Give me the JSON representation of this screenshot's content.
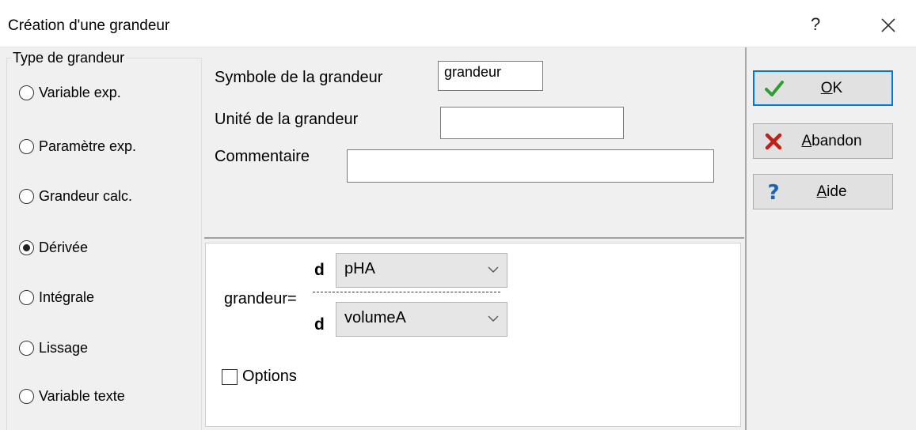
{
  "window": {
    "title": "Création d'une grandeur",
    "help_glyph": "?",
    "close_icon": "close-icon"
  },
  "type_group": {
    "legend": "Type de grandeur",
    "options": [
      {
        "label": "Variable exp.",
        "checked": false
      },
      {
        "label": "Paramètre exp.",
        "checked": false
      },
      {
        "label": "Grandeur calc.",
        "checked": false
      },
      {
        "label": "Dérivée",
        "checked": true
      },
      {
        "label": "Intégrale",
        "checked": false
      },
      {
        "label": "Lissage",
        "checked": false
      },
      {
        "label": "Variable texte",
        "checked": false
      }
    ]
  },
  "form": {
    "symbol_label": "Symbole de la grandeur",
    "symbol_value": "grandeur",
    "unit_label": "Unité de la grandeur",
    "unit_value": "",
    "comment_label": "Commentaire",
    "comment_value": ""
  },
  "derivative": {
    "lhs": "grandeur=",
    "d_top": "d",
    "numerator": "pHA",
    "d_bottom": "d",
    "denominator": "volumeA",
    "options_label": "Options",
    "options_checked": false
  },
  "buttons": {
    "ok": {
      "mnemonic": "O",
      "rest": "K",
      "icon": "check-icon",
      "color": "#2e9e2e"
    },
    "abandon": {
      "mnemonic": "A",
      "rest": "bandon",
      "icon": "cross-icon",
      "color": "#c0201a"
    },
    "aide": {
      "mnemonic": "A",
      "rest": "ide",
      "icon": "question-icon",
      "color": "#1c63b7"
    }
  },
  "colors": {
    "default_button_border": "#0078d7",
    "client_background": "#f0f0f0"
  }
}
